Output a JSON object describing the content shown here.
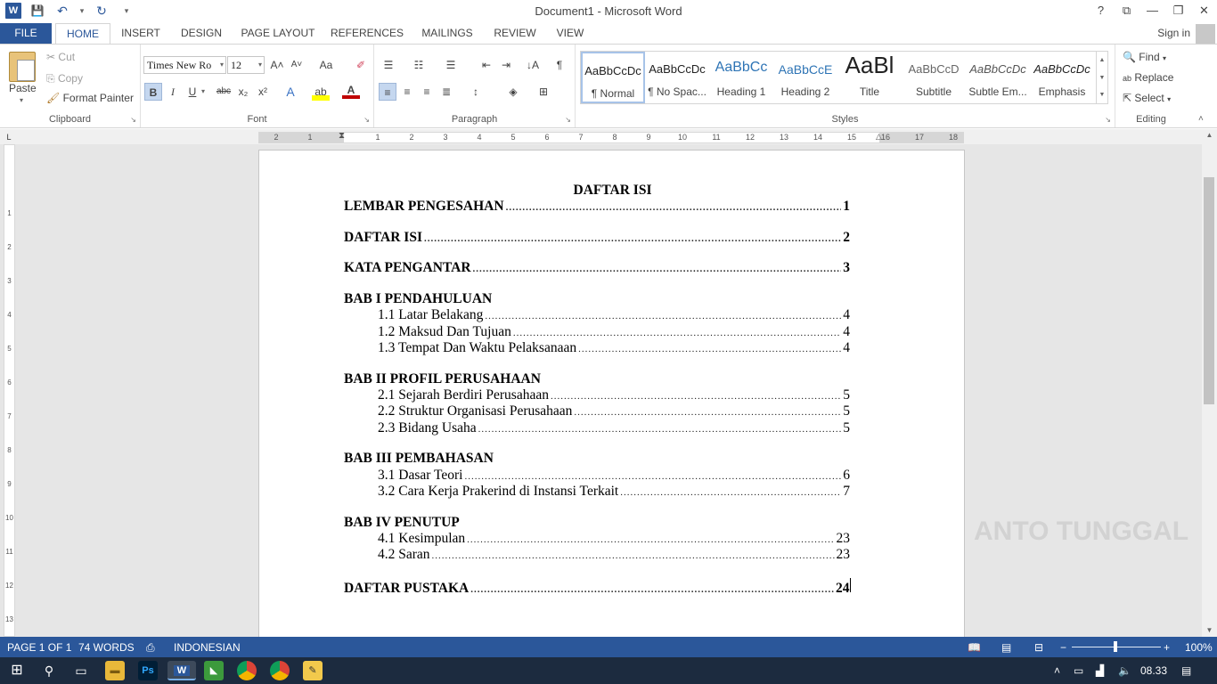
{
  "window": {
    "title": "Document1 - Microsoft Word",
    "help": "?",
    "restore_ribbon": "⧉",
    "minimize": "—",
    "maximize": "❐",
    "close": "✕"
  },
  "qat": {
    "logo": "W",
    "save": "💾",
    "undo": "↶",
    "undo_dd": "▾",
    "redo": "↻",
    "customize": "▾"
  },
  "tabs": [
    "FILE",
    "HOME",
    "INSERT",
    "DESIGN",
    "PAGE LAYOUT",
    "REFERENCES",
    "MAILINGS",
    "REVIEW",
    "VIEW"
  ],
  "signin": "Sign in",
  "clipboard": {
    "paste": "Paste",
    "cut": "Cut",
    "copy": "Copy",
    "format_painter": "Format Painter",
    "label": "Clipboard"
  },
  "font": {
    "name": "Times New Ro",
    "size": "12",
    "label": "Font",
    "bold": "B",
    "italic": "I",
    "underline": "U",
    "strike": "abc",
    "subscript": "x₂",
    "superscript": "x²",
    "grow": "A˄",
    "shrink": "A˅",
    "case": "Aa",
    "clear": "✐",
    "effects": "A",
    "highlight": "ab",
    "color": "A"
  },
  "paragraph": {
    "label": "Paragraph",
    "pilcrow": "¶",
    "sort": "↓A"
  },
  "styles": {
    "label": "Styles",
    "items": [
      {
        "sample": "AaBbCcDc",
        "name": "¶ Normal"
      },
      {
        "sample": "AaBbCcDc",
        "name": "¶ No Spac..."
      },
      {
        "sample": "AaBbCc",
        "name": "Heading 1"
      },
      {
        "sample": "AaBbCcE",
        "name": "Heading 2"
      },
      {
        "sample": "AaBl",
        "name": "Title"
      },
      {
        "sample": "AaBbCcD",
        "name": "Subtitle"
      },
      {
        "sample": "AaBbCcDc",
        "name": "Subtle Em..."
      },
      {
        "sample": "AaBbCcDc",
        "name": "Emphasis"
      }
    ]
  },
  "editing": {
    "find": "Find",
    "replace": "Replace",
    "select": "Select",
    "label": "Editing"
  },
  "ruler": {
    "numbers": [
      "2",
      "1",
      "1",
      "2",
      "3",
      "4",
      "5",
      "6",
      "7",
      "8",
      "9",
      "10",
      "11",
      "12",
      "13",
      "14",
      "15",
      "16",
      "17",
      "18"
    ],
    "vnumbers": [
      "1",
      "2",
      "3",
      "4",
      "5",
      "6",
      "7",
      "8",
      "9",
      "10",
      "11",
      "12",
      "13"
    ],
    "corner": "L"
  },
  "document": {
    "title": "DAFTAR ISI",
    "entries": [
      {
        "text": "LEMBAR PENGESAHAN",
        "page": "1"
      },
      {
        "text": "DAFTAR ISI",
        "page": "2"
      },
      {
        "text": "KATA PENGANTAR",
        "page": "3"
      }
    ],
    "chapters": [
      {
        "heading": "BAB I PENDAHULUAN",
        "subs": [
          {
            "text": "1.1 Latar Belakang",
            "page": "4"
          },
          {
            "text": "1.2 Maksud Dan Tujuan",
            "page": "4"
          },
          {
            "text": "1.3 Tempat Dan Waktu Pelaksanaan",
            "page": "4"
          }
        ]
      },
      {
        "heading": "BAB II PROFIL PERUSAHAAN",
        "subs": [
          {
            "text": "2.1 Sejarah Berdiri Perusahaan",
            "page": "5"
          },
          {
            "text": "2.2 Struktur Organisasi Perusahaan",
            "page": "5"
          },
          {
            "text": "2.3 Bidang Usaha",
            "page": "5"
          }
        ]
      },
      {
        "heading": "BAB III PEMBAHASAN",
        "subs": [
          {
            "text": "3.1 Dasar Teori",
            "page": "6"
          },
          {
            "text": "3.2 Cara Kerja Prakerind di Instansi Terkait",
            "page": "7"
          }
        ]
      },
      {
        "heading": "BAB IV PENUTUP",
        "subs": [
          {
            "text": "4.1 Kesimpulan",
            "page": "23"
          },
          {
            "text": "4.2 Saran",
            "page": "23"
          }
        ]
      }
    ],
    "final": {
      "text": "DAFTAR PUSTAKA",
      "page": "24"
    }
  },
  "watermark": "ANTO TUNGGAL",
  "status": {
    "page": "PAGE 1 OF 1",
    "words": "74 WORDS",
    "language": "INDONESIAN",
    "zoom": "100%",
    "zoom_minus": "−",
    "zoom_plus": "+"
  },
  "taskbar": {
    "time": "08.33"
  },
  "colors": {
    "accent": "#2b579a",
    "taskbar": "#1c2b3f",
    "workspace": "#e6e6e6"
  }
}
